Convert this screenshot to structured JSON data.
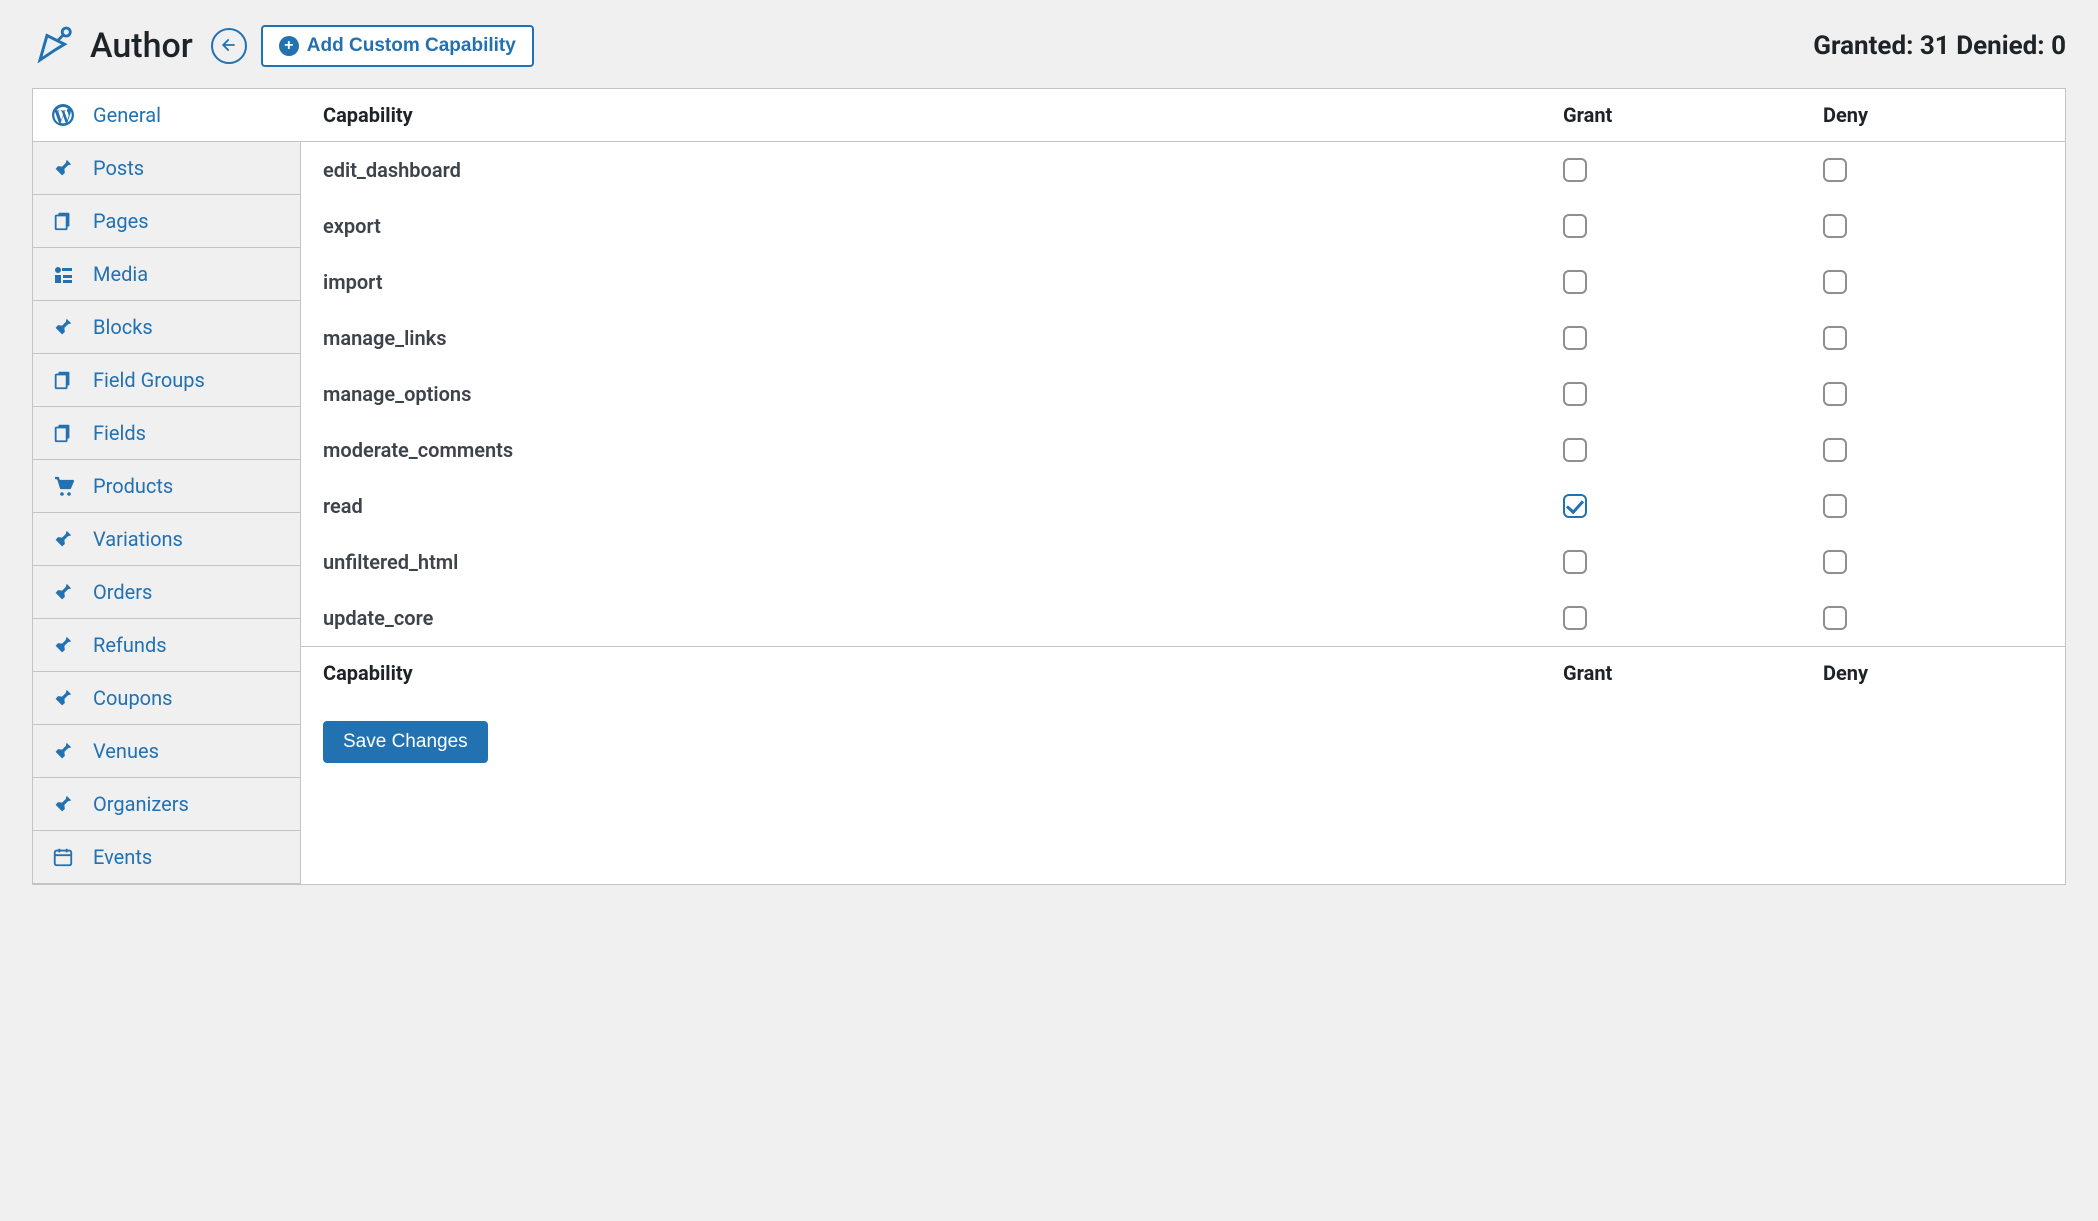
{
  "header": {
    "title": "Author",
    "add_custom_label": "Add Custom Capability",
    "granted_label": "Granted:",
    "granted_count": 31,
    "denied_label": "Denied:",
    "denied_count": 0
  },
  "sidebar": {
    "items": [
      {
        "label": "General",
        "icon": "wordpress",
        "active": true
      },
      {
        "label": "Posts",
        "icon": "pin"
      },
      {
        "label": "Pages",
        "icon": "copy"
      },
      {
        "label": "Media",
        "icon": "media"
      },
      {
        "label": "Blocks",
        "icon": "pin"
      },
      {
        "label": "Field Groups",
        "icon": "copy"
      },
      {
        "label": "Fields",
        "icon": "copy"
      },
      {
        "label": "Products",
        "icon": "cart"
      },
      {
        "label": "Variations",
        "icon": "pin"
      },
      {
        "label": "Orders",
        "icon": "pin"
      },
      {
        "label": "Refunds",
        "icon": "pin"
      },
      {
        "label": "Coupons",
        "icon": "pin"
      },
      {
        "label": "Venues",
        "icon": "pin"
      },
      {
        "label": "Organizers",
        "icon": "pin"
      },
      {
        "label": "Events",
        "icon": "calendar"
      }
    ]
  },
  "table": {
    "col_capability": "Capability",
    "col_grant": "Grant",
    "col_deny": "Deny",
    "rows": [
      {
        "name": "edit_dashboard",
        "grant": false,
        "deny": false
      },
      {
        "name": "export",
        "grant": false,
        "deny": false
      },
      {
        "name": "import",
        "grant": false,
        "deny": false
      },
      {
        "name": "manage_links",
        "grant": false,
        "deny": false
      },
      {
        "name": "manage_options",
        "grant": false,
        "deny": false
      },
      {
        "name": "moderate_comments",
        "grant": false,
        "deny": false
      },
      {
        "name": "read",
        "grant": true,
        "deny": false
      },
      {
        "name": "unfiltered_html",
        "grant": false,
        "deny": false
      },
      {
        "name": "update_core",
        "grant": false,
        "deny": false
      }
    ]
  },
  "actions": {
    "save": "Save Changes"
  }
}
